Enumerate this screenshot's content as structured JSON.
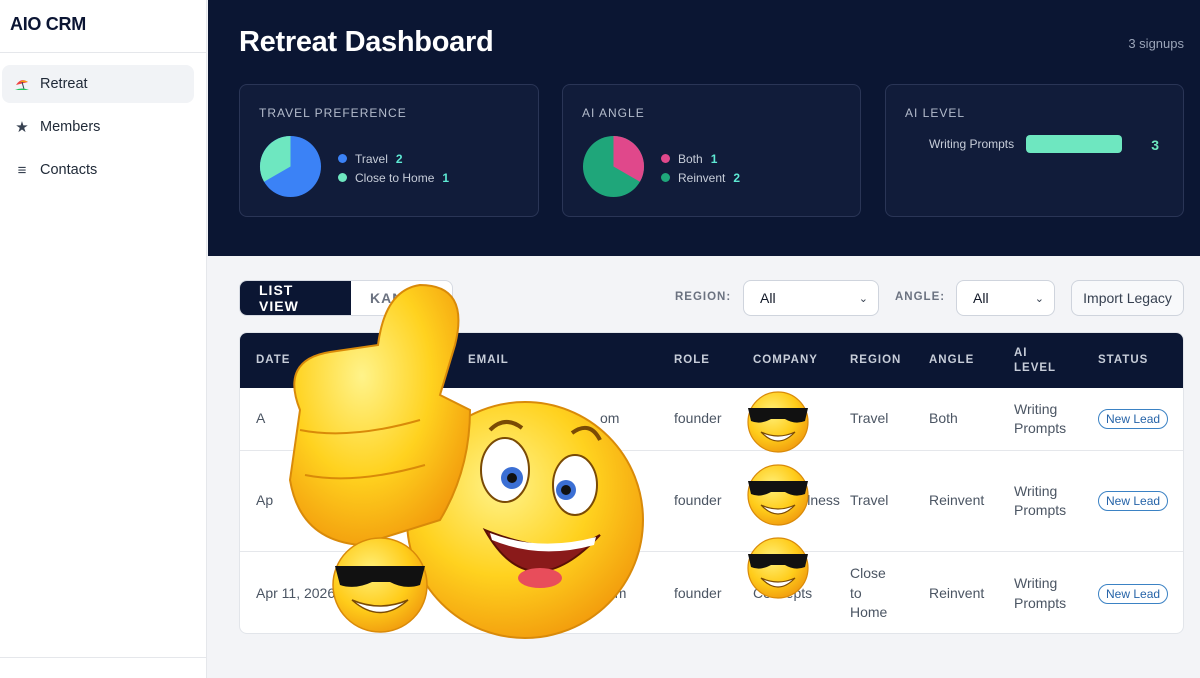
{
  "app": {
    "brand": "AIO CRM"
  },
  "sidebar": {
    "items": [
      {
        "label": "Retreat",
        "icon": "beach-umbrella-icon",
        "active": true
      },
      {
        "label": "Members",
        "icon": "star-icon",
        "active": false
      },
      {
        "label": "Contacts",
        "icon": "list-icon",
        "active": false
      }
    ]
  },
  "header": {
    "title": "Retreat Dashboard",
    "signups": "3 signups"
  },
  "cards": {
    "travel": {
      "title": "TRAVEL PREFERENCE",
      "items": [
        {
          "label": "Travel",
          "count": "2",
          "color": "#3b82f6"
        },
        {
          "label": "Close to Home",
          "count": "1",
          "color": "#6ee7c0"
        }
      ]
    },
    "angle": {
      "title": "AI ANGLE",
      "items": [
        {
          "label": "Both",
          "count": "1",
          "color": "#e0488b"
        },
        {
          "label": "Reinvent",
          "count": "2",
          "color": "#1fa67a"
        }
      ]
    },
    "level": {
      "title": "AI LEVEL",
      "items": [
        {
          "label": "Writing Prompts",
          "count": "3",
          "fraction": 1.0,
          "color": "#6ee7c0"
        }
      ]
    }
  },
  "toolbar": {
    "list_view": "LIST VIEW",
    "kanban_view": "KAN",
    "region_label": "REGION:",
    "region_value": "All",
    "angle_label": "ANGLE:",
    "angle_value": "All",
    "import_label": "Import Legacy"
  },
  "table": {
    "headers": [
      "DATE",
      "EMAIL",
      "ROLE",
      "COMPANY",
      "REGION",
      "ANGLE",
      "AI LEVEL",
      "STATUS"
    ],
    "rows": [
      {
        "date": "A",
        "email": "om",
        "role": "founder",
        "company": "",
        "region": "Travel",
        "angle": "Both",
        "level": "Writing Prompts",
        "status": "New Lead"
      },
      {
        "date": "Ap",
        "email": "",
        "role": "founder",
        "company": "A       cs Wellness",
        "region": "Travel",
        "angle": "Reinvent",
        "level": "Writing Prompts",
        "status": "New Lead"
      },
      {
        "date": "Apr 11, 2026",
        "email": "com",
        "role": "founder",
        "company": "Concepts",
        "region": "Close to Home",
        "angle": "Reinvent",
        "level": "Writing Prompts",
        "status": "New Lead"
      }
    ]
  },
  "colors": {
    "navy": "#0b1633",
    "accent_mint": "#6ee7c0",
    "badge_blue": "#2563a8"
  }
}
